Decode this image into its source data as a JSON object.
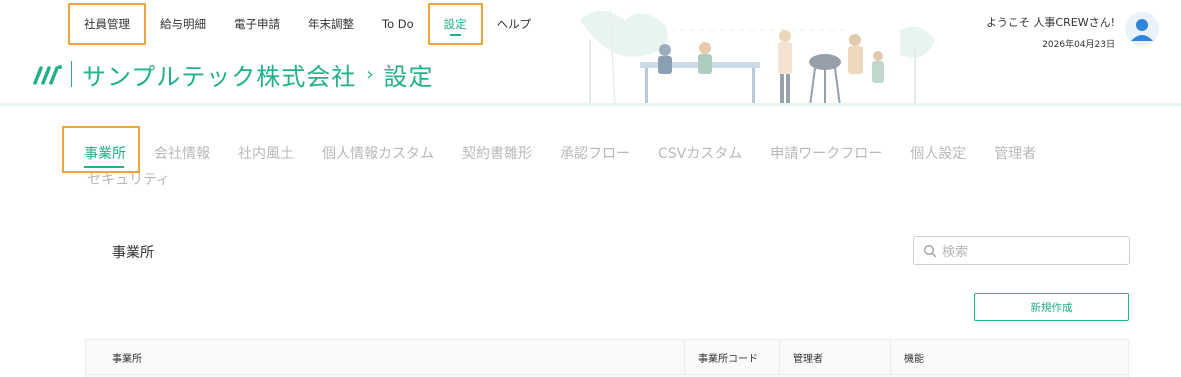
{
  "topnav": {
    "items": [
      {
        "label": "社員管理"
      },
      {
        "label": "給与明細"
      },
      {
        "label": "電子申請"
      },
      {
        "label": "年末調整"
      },
      {
        "label": "To Do"
      },
      {
        "label": "設定"
      },
      {
        "label": "ヘルプ"
      }
    ]
  },
  "user": {
    "welcome": "ようこそ 人事CREWさん!",
    "date": "2026年04月23日"
  },
  "brand": {
    "company": "サンプルテック株式会社",
    "separator": "›",
    "page": "設定"
  },
  "tabs": {
    "row1": [
      "事業所",
      "会社情報",
      "社内風土",
      "個人情報カスタム",
      "契約書雛形",
      "承認フロー",
      "CSVカスタム",
      "申請ワークフロー",
      "個人設定",
      "管理者"
    ],
    "row2": [
      "セキュリティ"
    ]
  },
  "section": {
    "title": "事業所",
    "search_placeholder": "検索",
    "new_button": "新規作成"
  },
  "table": {
    "headers": [
      "事業所",
      "事業所コード",
      "管理者",
      "機能"
    ]
  },
  "colors": {
    "accent": "#22b18a",
    "highlight_box": "#f2a33a"
  },
  "icons": {
    "logo": "brand-logo-icon",
    "avatar": "user-avatar-icon",
    "search": "search-icon"
  }
}
